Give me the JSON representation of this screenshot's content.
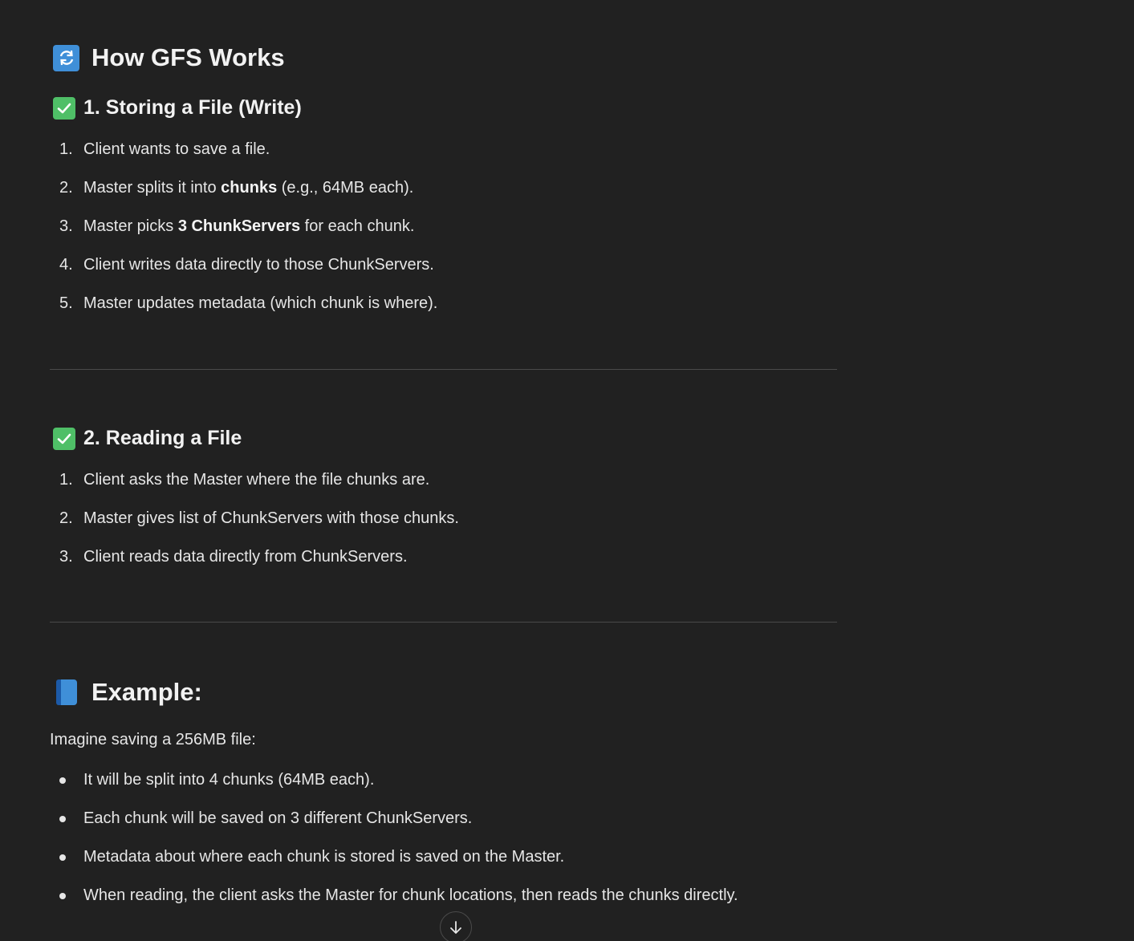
{
  "section_title": {
    "icon": "cycle-arrows-icon",
    "text": "How GFS Works"
  },
  "write_section": {
    "icon": "check-mark-icon",
    "title": "1. Storing a File (Write)",
    "steps": [
      {
        "num": "1.",
        "parts": [
          {
            "t": "Client wants to save a file."
          }
        ]
      },
      {
        "num": "2.",
        "parts": [
          {
            "t": "Master splits it into "
          },
          {
            "t": "chunks",
            "bold": true
          },
          {
            "t": " (e.g., 64MB each)."
          }
        ]
      },
      {
        "num": "3.",
        "parts": [
          {
            "t": "Master picks "
          },
          {
            "t": "3 ChunkServers",
            "bold": true
          },
          {
            "t": " for each chunk."
          }
        ]
      },
      {
        "num": "4.",
        "parts": [
          {
            "t": "Client writes data directly to those ChunkServers."
          }
        ]
      },
      {
        "num": "5.",
        "parts": [
          {
            "t": "Master updates metadata (which chunk is where)."
          }
        ]
      }
    ]
  },
  "read_section": {
    "icon": "check-mark-icon",
    "title": "2. Reading a File",
    "steps": [
      {
        "num": "1.",
        "parts": [
          {
            "t": "Client asks the Master where the file chunks are."
          }
        ]
      },
      {
        "num": "2.",
        "parts": [
          {
            "t": "Master gives list of ChunkServers with those chunks."
          }
        ]
      },
      {
        "num": "3.",
        "parts": [
          {
            "t": "Client reads data directly from ChunkServers."
          }
        ]
      }
    ]
  },
  "example_section": {
    "icon": "blue-book-icon",
    "title": "Example:",
    "intro": "Imagine saving a 256MB file:",
    "bullets": [
      "It will be split into 4 chunks (64MB each).",
      "Each chunk will be saved on 3 different ChunkServers.",
      "Metadata about where each chunk is stored is saved on the Master.",
      "When reading, the client asks the Master for chunk locations, then reads the chunks directly."
    ]
  },
  "scroll_button": {
    "icon": "arrow-down-icon"
  },
  "colors": {
    "background": "#212121",
    "text": "#ececec",
    "check_green": "#4fbf67",
    "cycle_blue": "#3f8fd8",
    "divider": "#4a4a4a"
  }
}
